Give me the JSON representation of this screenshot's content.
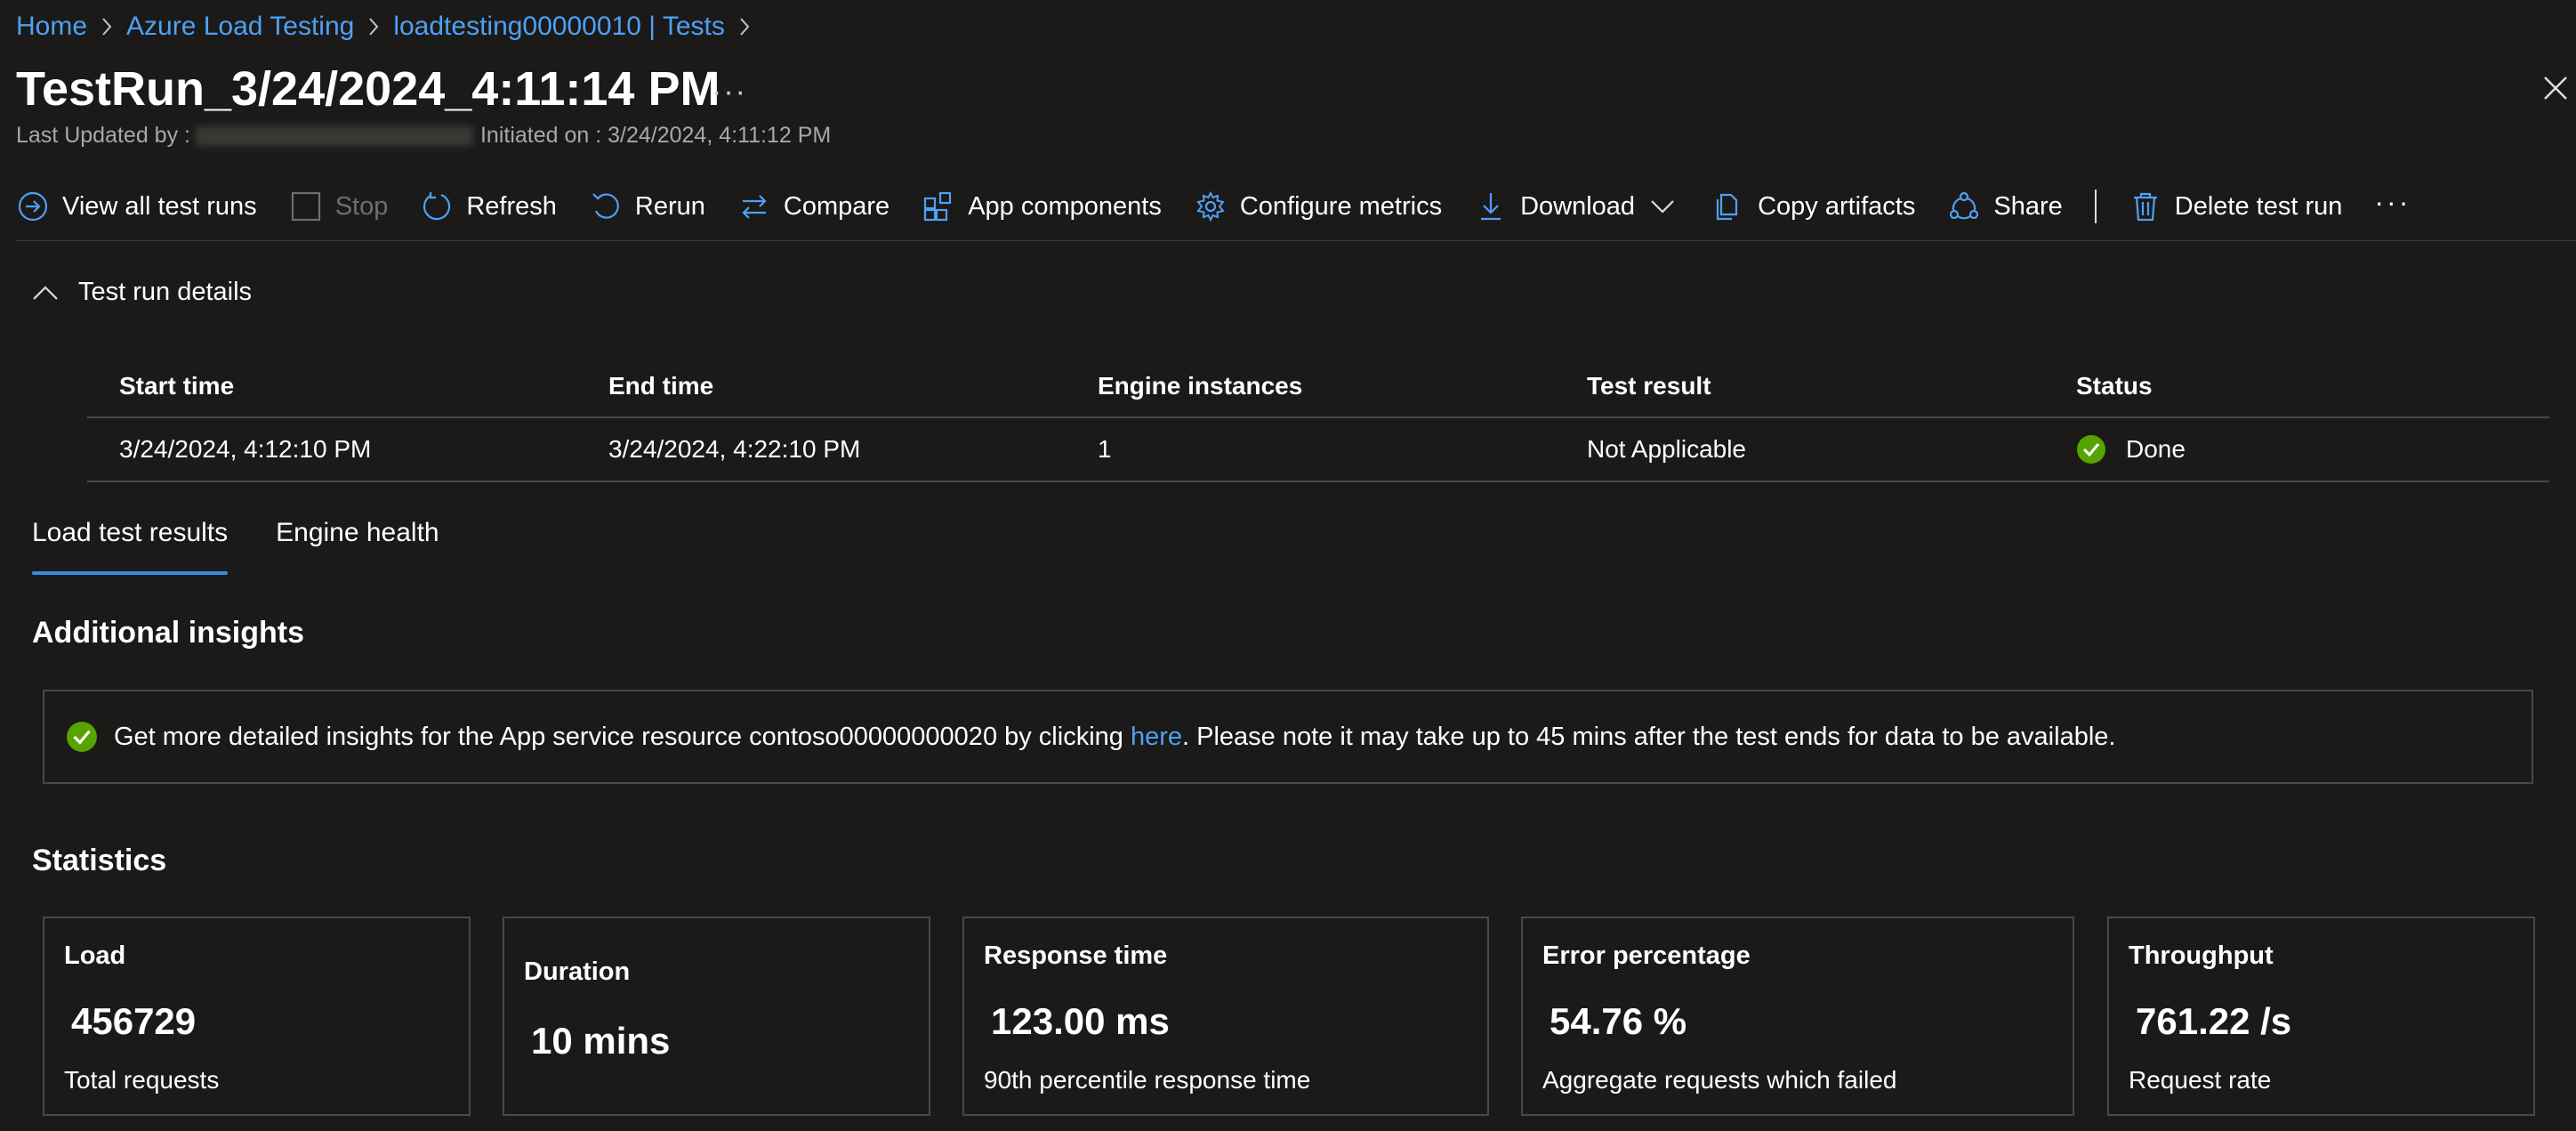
{
  "breadcrumb": [
    "Home",
    "Azure Load Testing",
    "loadtesting00000010 | Tests"
  ],
  "page": {
    "title": "TestRun_3/24/2024_4:11:14 PM",
    "more": "···",
    "last_updated_label": "Last Updated by :",
    "initiated_label": "Initiated on : 3/24/2024, 4:11:12 PM"
  },
  "toolbar": {
    "view_all": "View all test runs",
    "stop": "Stop",
    "refresh": "Refresh",
    "rerun": "Rerun",
    "compare": "Compare",
    "app_components": "App components",
    "configure_metrics": "Configure metrics",
    "download": "Download",
    "copy_artifacts": "Copy artifacts",
    "share": "Share",
    "delete": "Delete test run",
    "more": "···"
  },
  "details": {
    "section_title": "Test run details",
    "headers": [
      "Start time",
      "End time",
      "Engine instances",
      "Test result",
      "Status"
    ],
    "row": {
      "start": "3/24/2024, 4:12:10 PM",
      "end": "3/24/2024, 4:22:10 PM",
      "engines": "1",
      "result": "Not Applicable",
      "status": "Done"
    }
  },
  "tabs": [
    "Load test results",
    "Engine health"
  ],
  "insights": {
    "heading": "Additional insights",
    "text_before": "Get more detailed insights for the App service resource contoso00000000020 by clicking ",
    "link": "here",
    "text_after": ". Please note it may take up to 45 mins after the test ends for data to be available."
  },
  "statistics": {
    "heading": "Statistics",
    "cards": [
      {
        "title": "Load",
        "value": "456729",
        "sub": "Total requests"
      },
      {
        "title": "Duration",
        "value": "10 mins",
        "sub": ""
      },
      {
        "title": "Response time",
        "value": "123.00 ms",
        "sub": "90th percentile response time"
      },
      {
        "title": "Error percentage",
        "value": "54.76 %",
        "sub": "Aggregate requests which failed"
      },
      {
        "title": "Throughput",
        "value": "761.22 /s",
        "sub": "Request rate"
      }
    ]
  },
  "colors": {
    "background": "#1b1a19",
    "accent": "#4ea1f3",
    "success": "#57a300",
    "border": "#4a4948"
  }
}
